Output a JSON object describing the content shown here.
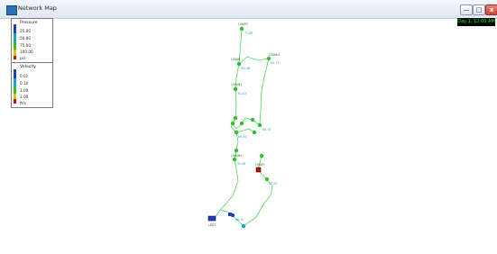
{
  "window": {
    "title": "Network Map",
    "buttons": {
      "minimize": "—",
      "maximize": "□",
      "close": "x"
    }
  },
  "time": "Day 1, 12:00 AM",
  "legend": {
    "pressure": {
      "title": "Pressure",
      "labels": [
        "25.00",
        "50.00",
        "75.00",
        "100.00",
        "psi"
      ],
      "colors": [
        "#1f3fbf",
        "#0fa9c9",
        "#2fbf2f",
        "#d6c800",
        "#d10a0a"
      ]
    },
    "velocity": {
      "title": "Velocity",
      "labels": [
        "0.01",
        "0.10",
        "1.00",
        "2.00",
        "ft/s"
      ],
      "colors": [
        "#1f3fbf",
        "#0fa9c9",
        "#2fbf2f",
        "#d6c800",
        "#d10a0a"
      ]
    }
  },
  "network": {
    "pipe_color": "#56d45a",
    "node_labels": [
      "J-MAP2",
      "J-TANK",
      "J-TANK3",
      "J-MAIN1",
      "J-MAIN2",
      "J-MAP1",
      "J-RES"
    ],
    "node_values": [
      "71.85",
      "82.48",
      "80.71",
      "61.03",
      "69.44",
      "86.70",
      "35.56",
      "52.34",
      "88.12"
    ]
  }
}
